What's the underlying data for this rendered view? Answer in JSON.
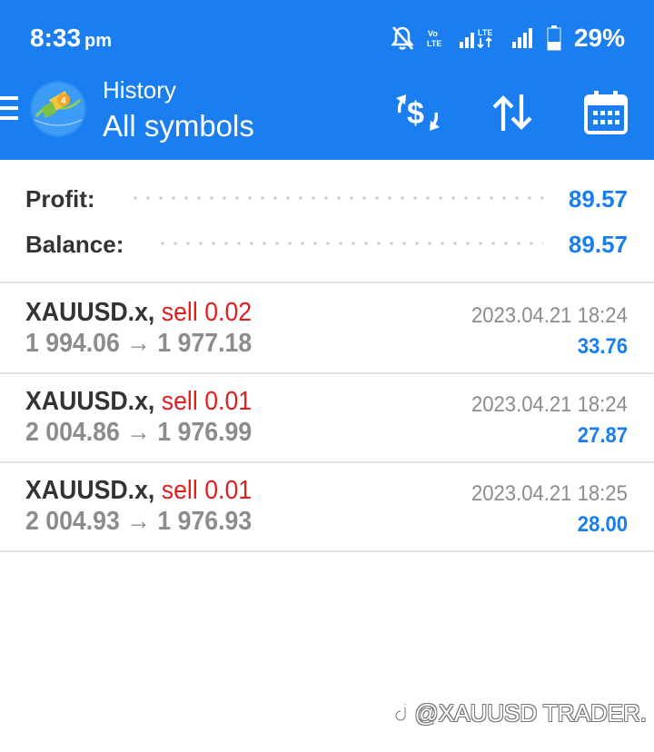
{
  "status_bar": {
    "time": "8:33",
    "ampm": "pm",
    "battery": "29%",
    "icons": [
      "notifications-off-icon",
      "volte-icon",
      "signal-lte-icon",
      "signal-icon",
      "battery-icon"
    ]
  },
  "header": {
    "title": "History",
    "subtitle": "All symbols",
    "actions": [
      "deposit-withdraw-icon",
      "sort-icon",
      "calendar-icon"
    ],
    "colors": {
      "bar": "#1a7ef0"
    }
  },
  "summary": {
    "profit_label": "Profit:",
    "profit_value": "89.57",
    "balance_label": "Balance:",
    "balance_value": "89.57"
  },
  "trades": [
    {
      "symbol": "XAUUSD.x,",
      "side": "sell 0.02",
      "prices": "1 994.06 → 1 977.18",
      "date": "2023.04.21 18:24",
      "profit": "33.76"
    },
    {
      "symbol": "XAUUSD.x,",
      "side": "sell 0.01",
      "prices": "2 004.86 → 1 976.99",
      "date": "2023.04.21 18:24",
      "profit": "27.87"
    },
    {
      "symbol": "XAUUSD.x,",
      "side": "sell 0.01",
      "prices": "2 004.93 → 1 976.93",
      "date": "2023.04.21 18:25",
      "profit": "28.00"
    }
  ],
  "watermark": "@XAUUSD TRADER."
}
